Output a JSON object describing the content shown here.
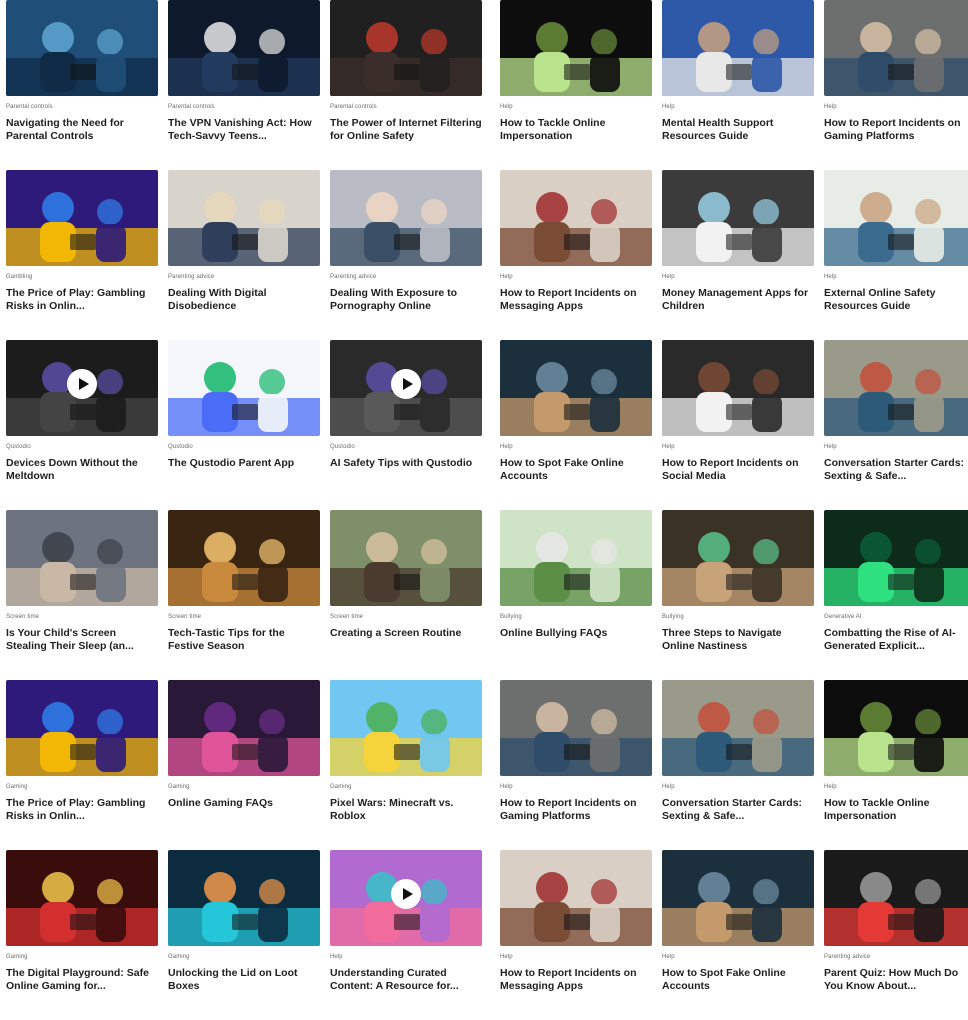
{
  "colors": {
    "tag_text": "#6a6a6a",
    "title_text": "#1f1f22",
    "play_button": "#ffffff"
  },
  "columns": {
    "left": [
      [
        {
          "tag": "Parental controls",
          "title": "Navigating the Need for Parental Controls",
          "icon": "shield-family-icon",
          "palette": [
            "#1f4e78",
            "#0f2b47",
            "#5fa8d3"
          ]
        },
        {
          "tag": "Parental controls",
          "title": "The VPN Vanishing Act: How Tech-Savvy Teens...",
          "icon": "vpn-lock-icon",
          "palette": [
            "#0e1a2b",
            "#223a5e",
            "#e8e8e8"
          ]
        },
        {
          "tag": "Parental controls",
          "title": "The Power of Internet Filtering for Online Safety",
          "icon": "phone-hands-icon",
          "palette": [
            "#202020",
            "#3b2d2a",
            "#c0392b"
          ]
        }
      ],
      [
        {
          "tag": "Gambling",
          "title": "The Price of Play: Gambling Risks in Onlin...",
          "icon": "loot-box-icon",
          "palette": [
            "#2d1a7a",
            "#f2b705",
            "#2f80ed"
          ]
        },
        {
          "tag": "Parenting advice",
          "title": "Dealing With Digital Disobedience",
          "icon": "gamer-headphones-icon",
          "palette": [
            "#d8d4cc",
            "#2f3e5a",
            "#e8d8b8"
          ]
        },
        {
          "tag": "Parenting advice",
          "title": "Dealing With Exposure to Pornography Online",
          "icon": "laptop-face-icon",
          "palette": [
            "#b9bcc4",
            "#3a4f66",
            "#f1d7c4"
          ]
        }
      ],
      [
        {
          "tag": "Qustodio",
          "title": "Devices Down Without the Meltdown",
          "icon": "video-play-icon",
          "palette": [
            "#1c1c1c",
            "#444444",
            "#5b4fa8"
          ],
          "video": true
        },
        {
          "tag": "Qustodio",
          "title": "The Qustodio Parent App",
          "icon": "dashboard-screen-icon",
          "palette": [
            "#f4f6fb",
            "#4a6cf7",
            "#12b76a"
          ]
        },
        {
          "tag": "Qustodio",
          "title": "AI Safety Tips with Qustodio",
          "icon": "video-play-icon",
          "palette": [
            "#2a2a2a",
            "#595959",
            "#5b4fa8"
          ],
          "video": true
        }
      ],
      [
        {
          "tag": "Screen time",
          "title": "Is Your Child's Screen Stealing Their Sleep (an...",
          "icon": "sleeping-child-icon",
          "palette": [
            "#6d7480",
            "#c9b8a6",
            "#3b3f46"
          ]
        },
        {
          "tag": "Screen time",
          "title": "Tech-Tastic Tips for the Festive Season",
          "icon": "festive-tablet-icon",
          "palette": [
            "#3a2412",
            "#c98a3d",
            "#f7c873"
          ]
        },
        {
          "tag": "Screen time",
          "title": "Creating a Screen Routine",
          "icon": "family-phone-icon",
          "palette": [
            "#7f8f6a",
            "#4a3b2e",
            "#d9c3a1"
          ]
        }
      ],
      [
        {
          "tag": "Gaming",
          "title": "The Price of Play: Gambling Risks in Onlin...",
          "icon": "loot-box-icon",
          "palette": [
            "#2d1a7a",
            "#f2b705",
            "#2f80ed"
          ]
        },
        {
          "tag": "Gaming",
          "title": "Online Gaming FAQs",
          "icon": "gamer-neon-icon",
          "palette": [
            "#2a1838",
            "#e0559a",
            "#6b2d8a"
          ]
        },
        {
          "tag": "Gaming",
          "title": "Pixel Wars: Minecraft vs. Roblox",
          "icon": "pixel-win-icon",
          "palette": [
            "#6fc7f2",
            "#f5d43b",
            "#4caf50"
          ]
        }
      ],
      [
        {
          "tag": "Gaming",
          "title": "The Digital Playground: Safe Online Gaming for...",
          "icon": "gamer-group-icon",
          "palette": [
            "#3a0d0d",
            "#d32f2f",
            "#f2c94c"
          ]
        },
        {
          "tag": "Gaming",
          "title": "Unlocking the Lid on Loot Boxes",
          "icon": "treasure-chest-icon",
          "palette": [
            "#0c2b3f",
            "#26c6da",
            "#f2994a"
          ]
        },
        {
          "tag": "Help",
          "title": "Understanding Curated Content: A Resource for...",
          "icon": "curating-video-icon",
          "palette": [
            "#b06ad0",
            "#f16b9c",
            "#35c3c8"
          ],
          "video": true
        }
      ]
    ],
    "right": [
      [
        {
          "tag": "Help",
          "title": "How to Tackle Online Impersonation",
          "icon": "hooded-laptop-icon",
          "palette": [
            "#0d0d0d",
            "#b9e28c",
            "#6a8f3a"
          ]
        },
        {
          "tag": "Help",
          "title": "Mental Health Support Resources Guide",
          "icon": "classroom-icon",
          "palette": [
            "#2e59a8",
            "#e8e8e8",
            "#c9a27e"
          ]
        },
        {
          "tag": "Help",
          "title": "How to Report Incidents on Gaming Platforms",
          "icon": "teens-sofa-icon",
          "palette": [
            "#6d6f6f",
            "#2f4d6b",
            "#d9c2a8"
          ]
        }
      ],
      [
        {
          "tag": "Help",
          "title": "How to Report Incidents on Messaging Apps",
          "icon": "worried-mother-icon",
          "palette": [
            "#d9cfc4",
            "#7a4b35",
            "#9e2a2b"
          ]
        },
        {
          "tag": "Help",
          "title": "Money Management Apps for Children",
          "icon": "piggy-bank-icon",
          "palette": [
            "#3b3b3b",
            "#f2f2f2",
            "#9ad1e8"
          ]
        },
        {
          "tag": "Help",
          "title": "External Online Safety Resources Guide",
          "icon": "boy-phone-icon",
          "palette": [
            "#e7ece6",
            "#3b6b8f",
            "#c9a27e"
          ]
        }
      ],
      [
        {
          "tag": "Help",
          "title": "How to Spot Fake Online Accounts",
          "icon": "paper-bag-head-icon",
          "palette": [
            "#1c2f3d",
            "#c49a6c",
            "#6f8ea4"
          ]
        },
        {
          "tag": "Help",
          "title": "How to Report Incidents on Social Media",
          "icon": "girls-phone-icon",
          "palette": [
            "#2a2a2a",
            "#f2f2f2",
            "#7a4b35"
          ]
        },
        {
          "tag": "Help",
          "title": "Conversation Starter Cards: Sexting & Safe...",
          "icon": "couple-phone-icon",
          "palette": [
            "#9a9a8a",
            "#2e5a7a",
            "#c44d3a"
          ]
        }
      ],
      [
        {
          "tag": "Bullying",
          "title": "Online Bullying FAQs",
          "icon": "bullied-boy-icon",
          "palette": [
            "#cfe3c7",
            "#5a8f45",
            "#e8e8e8"
          ]
        },
        {
          "tag": "Bullying",
          "title": "Three Steps to Navigate Online Nastiness",
          "icon": "crying-girl-icon",
          "palette": [
            "#3b3226",
            "#c8a37a",
            "#58c48c"
          ]
        },
        {
          "tag": "Generative AI",
          "title": "Combatting the Rise of AI-Generated Explicit...",
          "icon": "ai-face-icon",
          "palette": [
            "#0d2b1a",
            "#2ee07f",
            "#0b5e3a"
          ]
        }
      ],
      [
        {
          "tag": "Help",
          "title": "How to Report Incidents on Gaming Platforms",
          "icon": "teens-sofa-icon",
          "palette": [
            "#6d6f6f",
            "#2f4d6b",
            "#d9c2a8"
          ]
        },
        {
          "tag": "Help",
          "title": "Conversation Starter Cards: Sexting & Safe...",
          "icon": "couple-phone-icon",
          "palette": [
            "#9a9a8a",
            "#2e5a7a",
            "#c44d3a"
          ]
        },
        {
          "tag": "Help",
          "title": "How to Tackle Online Impersonation",
          "icon": "hooded-laptop-icon",
          "palette": [
            "#0d0d0d",
            "#b9e28c",
            "#6a8f3a"
          ]
        }
      ],
      [
        {
          "tag": "Help",
          "title": "How to Report Incidents on Messaging Apps",
          "icon": "worried-mother-icon",
          "palette": [
            "#d9cfc4",
            "#7a4b35",
            "#9e2a2b"
          ]
        },
        {
          "tag": "Help",
          "title": "How to Spot Fake Online Accounts",
          "icon": "paper-bag-head-icon",
          "palette": [
            "#1c2f3d",
            "#c49a6c",
            "#6f8ea4"
          ]
        },
        {
          "tag": "Parenting advice",
          "title": "Parent Quiz: How Much Do You Know About...",
          "icon": "heart-phone-icon",
          "palette": [
            "#1a1a1a",
            "#e53935",
            "#9e9e9e"
          ]
        }
      ]
    ]
  }
}
